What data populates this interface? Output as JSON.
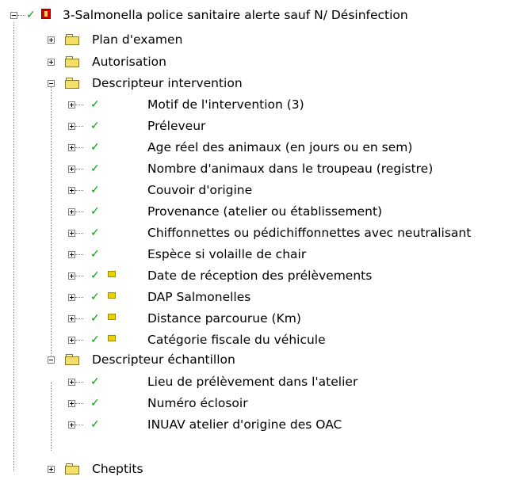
{
  "tree": {
    "root": {
      "label": "3-Salmonella police sanitaire alerte sauf N/ Désinfection",
      "check_icon": "check-icon",
      "badge_icon": "red-document-icon",
      "color_check": "#00a000"
    },
    "groups": [
      {
        "label": "Plan d'examen"
      },
      {
        "label": "Autorisation"
      },
      {
        "label": "Descripteur intervention"
      },
      {
        "label": "Descripteur échantillon"
      },
      {
        "label": "Cheptits"
      }
    ],
    "intervention_items": [
      {
        "label": "Motif de l'intervention (3)",
        "flag": false
      },
      {
        "label": "Préleveur",
        "flag": false
      },
      {
        "label": "Age réel des animaux (en jours ou en sem)",
        "flag": false
      },
      {
        "label": "Nombre d'animaux dans le troupeau (registre)",
        "flag": false
      },
      {
        "label": "Couvoir d'origine",
        "flag": false
      },
      {
        "label": "Provenance (atelier ou établissement)",
        "flag": false
      },
      {
        "label": "Chiffonnettes ou pédichiffonnettes avec neutralisant",
        "flag": false
      },
      {
        "label": "Espèce si volaille de chair",
        "flag": false
      },
      {
        "label": "Date de réception des prélèvements",
        "flag": true
      },
      {
        "label": "DAP Salmonelles",
        "flag": true
      },
      {
        "label": "Distance parcourue (Km)",
        "flag": true
      },
      {
        "label": "Catégorie fiscale du véhicule",
        "flag": true
      }
    ],
    "echantillon_items": [
      {
        "label": "Lieu de prélèvement dans l'atelier"
      },
      {
        "label": "Numéro  éclosoir"
      },
      {
        "label": "INUAV atelier d'origine des OAC"
      }
    ]
  }
}
